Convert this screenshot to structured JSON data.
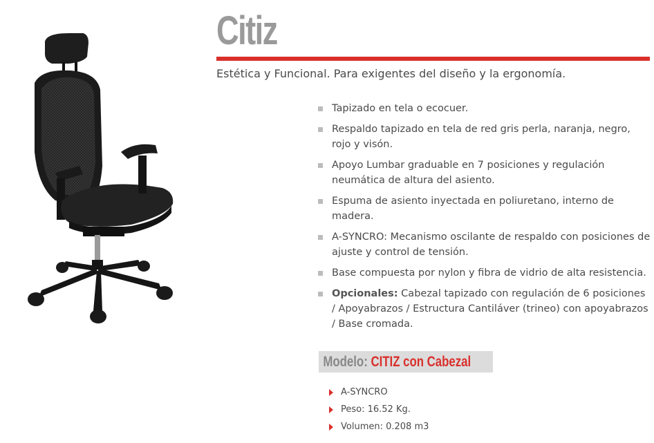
{
  "product": {
    "title": "Citiz",
    "subtitle": "Estética y Funcional. Para exigentes del diseño y la ergonomía.",
    "image_icon": "office-chair-image"
  },
  "features": [
    {
      "text": "Tapizado en tela o ecocuer."
    },
    {
      "text": "Respaldo tapizado en tela de red gris perla, naranja, negro, rojo y visón."
    },
    {
      "text": "Apoyo Lumbar graduable en 7 posiciones y regulación neumática de altura del asiento."
    },
    {
      "text": "Espuma de asiento inyectada en poliuretano, interno de madera."
    },
    {
      "text": "A-SYNCRO: Mecanismo oscilante de respaldo con posiciones de ajuste y control de tensión."
    },
    {
      "text": "Base compuesta por nylon y fibra de vidrio de alta resistencia."
    },
    {
      "label": "Opcionales:",
      "text": " Cabezal tapizado con regulación de 6 posiciones / Apoyabrazos / Estructura Cantiláver (trineo) con apoyabrazos / Base cromada."
    }
  ],
  "modelo": {
    "label": "Modelo:",
    "value": "CITIZ con Cabezal"
  },
  "specs": [
    "A-SYNCRO",
    "Peso: 16.52 Kg.",
    "Volumen: 0.208 m3"
  ],
  "colors": {
    "accent": "#d9302c",
    "title_gray": "#9a9a9a",
    "bullet_gray": "#bcbcbc",
    "modelo_bg": "#dcdcdc"
  }
}
